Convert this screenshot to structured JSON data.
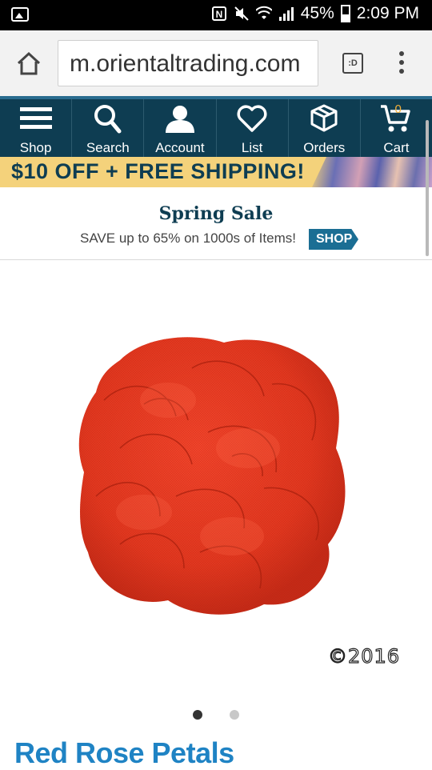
{
  "status_bar": {
    "battery_percent": "45%",
    "time": "2:09 PM",
    "icons": [
      "gallery-icon",
      "nfc-icon",
      "mute-icon",
      "wifi-icon",
      "signal-icon",
      "battery-icon"
    ],
    "battery_level": 0.45
  },
  "browser": {
    "url": "m.orientaltrading.com",
    "tabs_label": ":D"
  },
  "nav": {
    "items": [
      {
        "label": "Shop",
        "icon": "menu-icon"
      },
      {
        "label": "Search",
        "icon": "search-icon"
      },
      {
        "label": "Account",
        "icon": "account-icon"
      },
      {
        "label": "List",
        "icon": "heart-icon"
      },
      {
        "label": "Orders",
        "icon": "box-icon"
      },
      {
        "label": "Cart",
        "icon": "cart-icon"
      }
    ],
    "cart_count": "0"
  },
  "promo": {
    "text": "$10 OFF + FREE SHIPPING!"
  },
  "sale": {
    "title": "Spring Sale",
    "subtitle": "SAVE up to 65% on 1000s of Items!",
    "button_label": "SHOP"
  },
  "product": {
    "image_subject": "red rose petals",
    "copyright": "©2016",
    "title": "Red Rose Petals",
    "carousel_total": 2,
    "carousel_active": 1
  },
  "colors": {
    "nav_bg": "#0e3d52",
    "promo_bg": "#f4d27b",
    "title_blue": "#1f83c4",
    "cart_accent": "#f3b03a"
  }
}
